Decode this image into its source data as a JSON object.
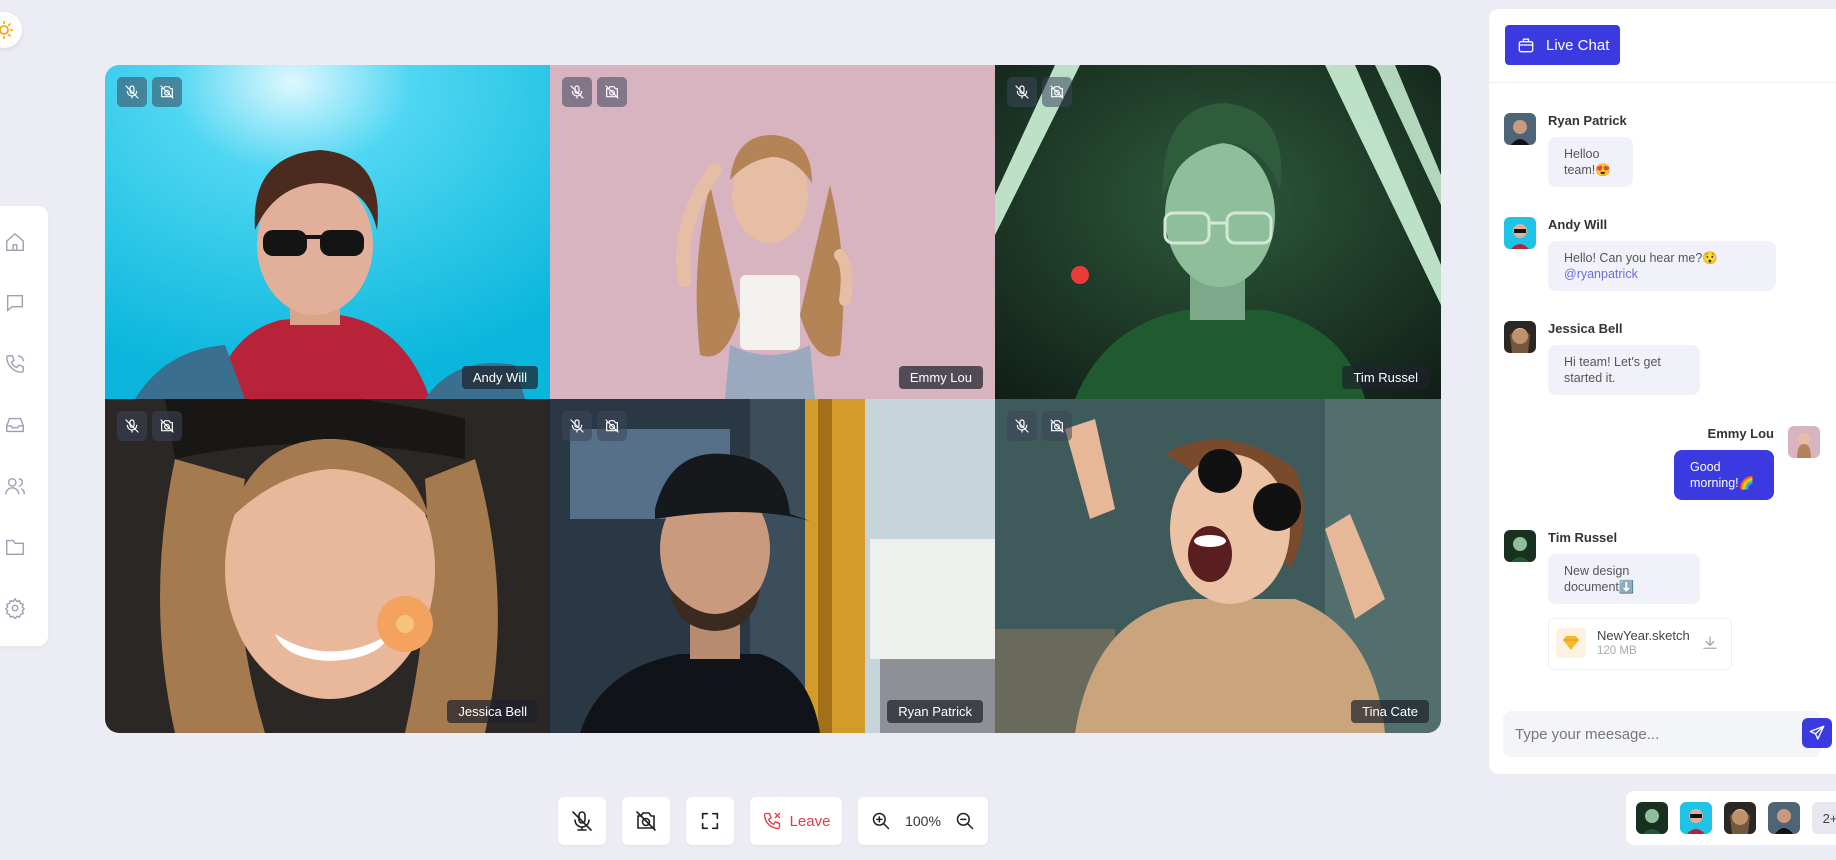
{
  "colors": {
    "accent": "#3a3ae0",
    "leave": "#e33b46",
    "background": "#ececf5",
    "bubble": "#f1f2f9"
  },
  "sidebar": {
    "items": [
      {
        "icon": "home-icon"
      },
      {
        "icon": "chat-icon"
      },
      {
        "icon": "phone-icon"
      },
      {
        "icon": "inbox-icon"
      },
      {
        "icon": "users-icon"
      },
      {
        "icon": "folder-icon"
      },
      {
        "icon": "settings-icon"
      }
    ]
  },
  "video": {
    "tiles": [
      {
        "name": "Andy Will"
      },
      {
        "name": "Emmy Lou"
      },
      {
        "name": "Tim Russel"
      },
      {
        "name": "Jessica Bell"
      },
      {
        "name": "Ryan Patrick"
      },
      {
        "name": "Tina Cate"
      }
    ]
  },
  "controls": {
    "leave_label": "Leave",
    "zoom_value": "100%"
  },
  "chat": {
    "title": "Live Chat",
    "messages": [
      {
        "sender": "Ryan Patrick",
        "text": "Helloo team!😍"
      },
      {
        "sender": "Andy Will",
        "text": "Hello! Can you hear me?😯",
        "mention": "@ryanpatrick"
      },
      {
        "sender": "Jessica Bell",
        "text": "Hi team! Let's get started it."
      },
      {
        "sender": "Emmy Lou",
        "text": "Good morning!🌈"
      },
      {
        "sender": "Tim Russel",
        "text": "New design document⬇️"
      }
    ],
    "file": {
      "name": "NewYear.sketch",
      "size": "120 MB"
    },
    "input_placeholder": "Type your meesage..."
  },
  "participants": {
    "more": "2+"
  }
}
